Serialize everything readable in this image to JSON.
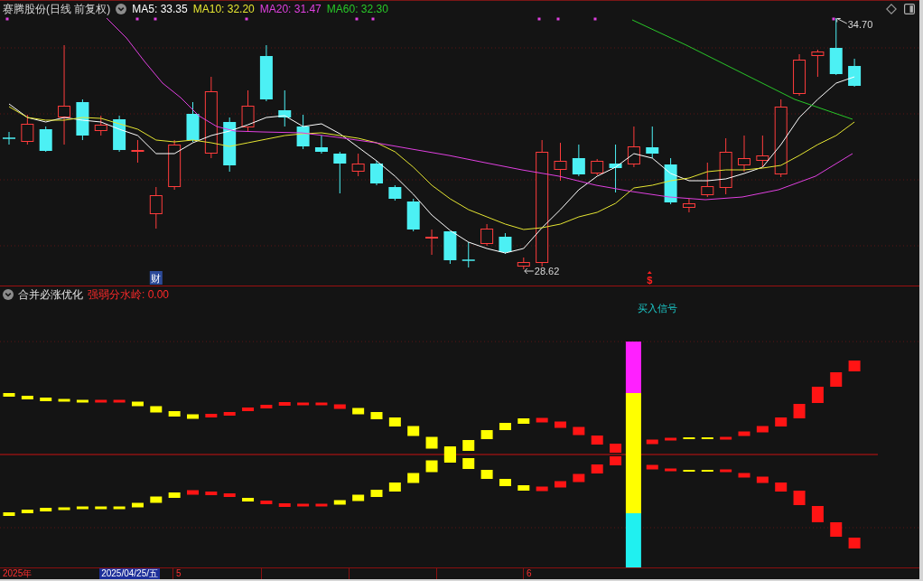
{
  "chart_header": {
    "title": "赛腾股份(日线 前复权)",
    "indicators": [
      {
        "label": "MA5: 33.35",
        "color": "#ffffff"
      },
      {
        "label": "MA10: 32.20",
        "color": "#e6e632"
      },
      {
        "label": "MA20: 31.47",
        "color": "#e040e0"
      },
      {
        "label": "MA60: 32.30",
        "color": "#28c828"
      }
    ]
  },
  "price_labels": [
    {
      "kind": "high",
      "text": "34.70"
    },
    {
      "kind": "low",
      "text": "28.62"
    }
  ],
  "event_markers": [
    {
      "kind": "finance",
      "text": "财"
    },
    {
      "kind": "dividend",
      "text": "$"
    }
  ],
  "indicator_panel": {
    "title": "合并必涨优化",
    "readout": "强弱分水岭: 0.00",
    "signal_label": "买入信号"
  },
  "time_axis": {
    "year": "2025年",
    "selected_date": "2025/04/25/五",
    "ticks": [
      "5",
      "6"
    ]
  }
}
